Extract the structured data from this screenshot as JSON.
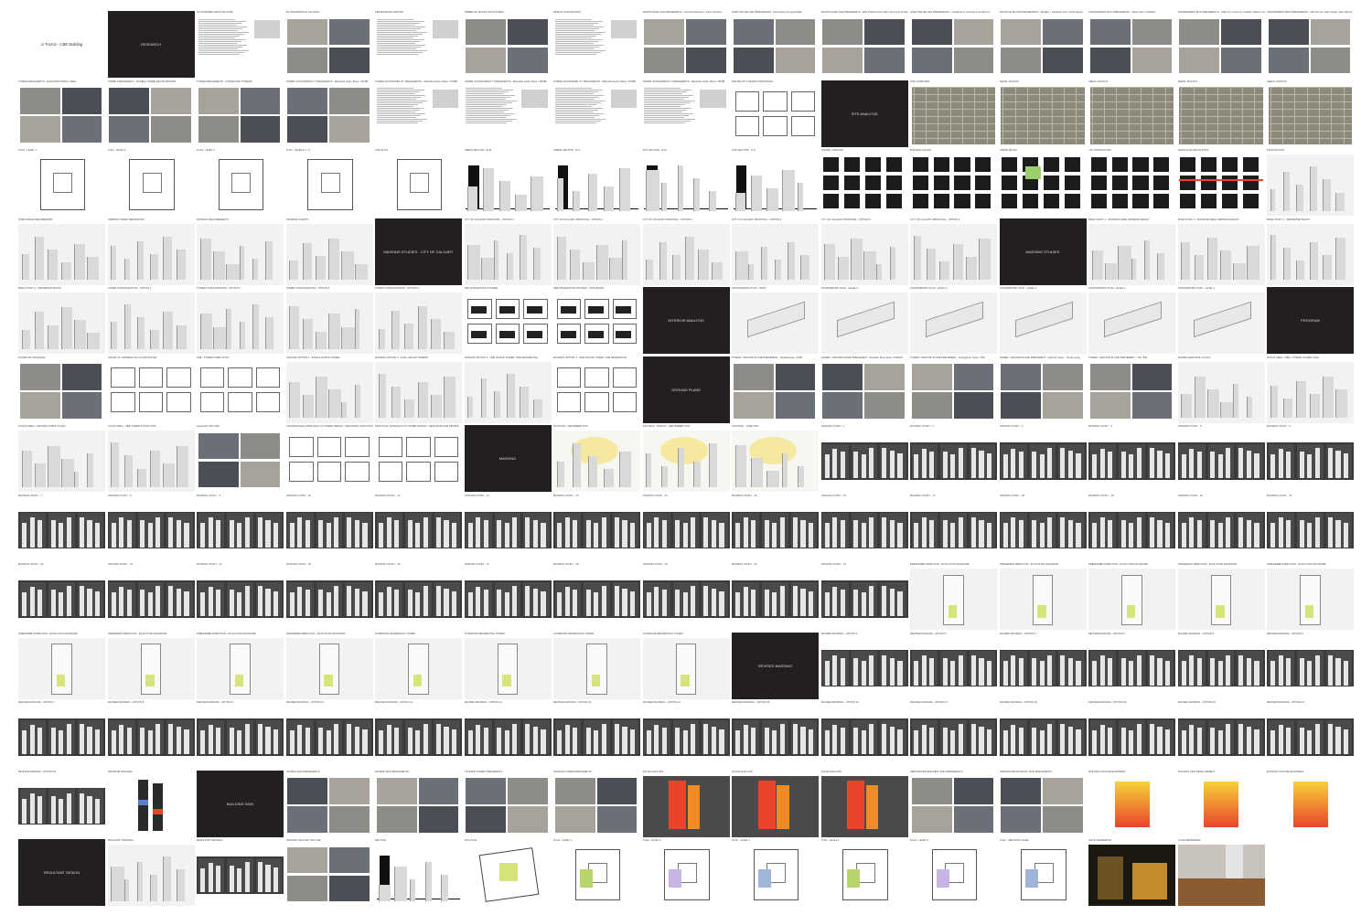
{
  "sheet": {
    "cols": 15,
    "rows": 13
  },
  "colors": {
    "dark": "#231f20",
    "strip": "#3a3a3a",
    "bldg": "#d9d9d9",
    "map": "#8d8a7c",
    "accent_yellow": "#f2de5a",
    "accent_red": "#e8452a"
  },
  "rows": [
    [
      "cover:ci TALKS - CBE Building",
      "dark:RESEARCH",
      "text:SKYSCRAPER ARCHITECTURE",
      "photo:SKYSCRAPERS IN CALGARY",
      "text:CBE BUILDING HISTORY",
      "photo:TIMBER OF MAJOR SCULPTURES",
      "text:DESIGN CONSTRAINTS",
      "photo:ADAPTIVE RE-USE PRECEDENTS - Kolumba Museum / Peter Zumthor",
      "photo:ADAPTIVE RE-USE PRECEDENTS - Nuremberg Kongresshalle",
      "photo:ADAPTIVE RE-USE PRECEDENTS - Elbe Philharmonic Hall / Herzog & de Meuron",
      "photo:ADAPTIVE RE-USE PRECEDENTS - CaixaForum / Herzog & de Meuron",
      "photo:ADAPTIVE RE-USE PRECEDENTS - Metallic + Aesthetic Fire / Adrià Hanes",
      "photo:TRANSPARENT BOX PRECEDENTS - Glass Farm / MVRDV",
      "photo:TRANSPARENT BOX PRECEDENTS - Office for Lonely by Castillo / Alberto Campo",
      "photo:TRANSPARENT BOX PRECEDENTS - 295 Concert Hall / Atelier Jean Nouvel"
    ],
    [
      "photo:TOWER PRECEDENTS - ELEVATED PUBLIC AREA",
      "photo:TOWER PRECEDENTS - DOUBLE TOWER RELATIONSHIPS",
      "photo:TOWER PRECEDENTS - CONNECTED TOWERS",
      "photo:TOWER SUSTAINABILITY PRECEDENTS - Manitoba Hydro Place / KPMB",
      "text:TOWER SUSTAINABILITY PRECEDENTS - Manitoba Hydro Place / KPMB",
      "text:TOWER SUSTAINABILITY PRECEDENTS - Manitoba Hydro Place / KPMB",
      "text:TOWER SUSTAINABILITY PRECEDENTS - Manitoba Hydro Place / KPMB",
      "text:TOWER SUSTAINABILITY PRECEDENTS - Manitoba Hydro Place / KPMB",
      "diagram:WINTER CITY DESIGN PRINCIPLES",
      "dark:SITE ANALYSIS",
      "map:SITE OVERVIEW",
      "map:AERIAL PHOTOS",
      "map:AERIAL PHOTOS",
      "map:AERIAL PHOTOS",
      "map:AERIAL PHOTOS"
    ],
    [
      "plan:PLAN - LEVEL 1",
      "plan:PLAN - LEVEL 2",
      "plan:PLAN - LEVEL 3",
      "plan:PLAN - LEVELS 4 + 5",
      "plan:SITE PLAN",
      "section:URBAN SECTION - E-W",
      "section:URBAN SECTION - N-S",
      "section:SITE SECTION - E-W",
      "section:SITE SECTION - N-S",
      "figure:FIGURE / GROUND",
      "figure:BUILDING HEIGHT",
      "figure:GREEN SPACE",
      "figure:+15 CONNECTIONS",
      "figure:VEHICULAR CIRCULATION",
      "massing:EXISTING SITE"
    ],
    [
      "massing:OPEN SPACE REQUIREMENT",
      "massing:MINIMUM TOWER SEPARATION",
      "massing:SETBACK REQUIREMENTS",
      "massing:MAXIMUM CANOPY",
      "dark:MASSING STUDIES - CITY OF CALGARY",
      "massing:CITY OF CALGARY PROPOSAL - OPTION 1",
      "massing:CITY OF CALGARY PROPOSAL - OPTION 1",
      "massing:CITY OF CALGARY PROPOSAL - OPTION 2",
      "massing:CITY OF CALGARY PROPOSAL - OPTION 2",
      "massing:CITY OF CALGARY PROPOSAL - OPTION 3",
      "massing:CITY OF CALGARY PROPOSAL - OPTION 4",
      "dark:MASSING STUDIES",
      "massing:BASE STUDY 1 - MAXIMUM AREA, MINIMUM HEIGHT",
      "massing:BASE STUDY 2 - MAXIMUM AREA, MINIMUM HEIGHT",
      "massing:BASE STUDY 3 - PERIMETER BLOCK"
    ],
    [
      "massing:BASE STUDY 4 - PERIMETER BLOCK",
      "massing:TOWER CONFIGURATION - OPTION 1",
      "massing:TOWER CONFIGURATION - OPTION 2",
      "massing:TOWER CONFIGURATION - OPTION 3",
      "massing:TOWER CONFIGURATION - OPTION 4",
      "cbe:CBE INTEGRATION STUDIES",
      "cbe:CBE INTEGRATION STUDIES - CONTINUED",
      "dark:INTERIOR ANALYSIS",
      "axo:AXONOMETRIC PLAN - ROOF",
      "axo:AXONOMETRIC PLAN - LEVEL 5",
      "axo:AXONOMETRIC PLAN - LEVEL 4",
      "axo:AXONOMETRIC PLAN - LEVEL 3",
      "axo:AXONOMETRIC PLAN - LEVEL 2",
      "axo:AXONOMETRIC PLAN - LEVEL 1",
      "dark:PROGRAM"
    ],
    [
      "photo:POTENTIAL PROGRAM",
      "diagram:OFFICE VS. RESIDENTIAL FLOOR PLATES",
      "diagram:CBE - TOWER CORE STUDY",
      "massing:MASSING OPTION 1 - SINGLE OFFICE TOWER",
      "massing:MASSING OPTION 2 - DUAL OFFICE TOWERS",
      "massing:MASSING OPTION 3 - ONE OFFICE TOWER, ONE RESIDENTIAL",
      "diagram:MASSING OPTION 4 - ONE OFFICE TOWER, ONE RESIDENTIAL",
      "dark:GROUND PLANE",
      "photo:TOWER / GROUND PLANE PRECEDENT - Mediatheque / 1998",
      "photo:TOWER / GROUND PLANE PRECEDENT - Roskilde Skyscraper / MVRDV",
      "photo:TOWER / GROUND PLANE PRECEDENT - Guangzhou Tower / BIG",
      "photo:TOWER / GROUND PLANE PRECEDENT - Highrise Tower - Studio Gang",
      "photo:TOWER / GROUND PLANE PRECEDENT - 730 / BIG",
      "massing:ESTABLISHED SITE LAYOUT",
      "massing:FOCUS AREA - CBE + TOWER CONNECTION"
    ],
    [
      "massing:FOCUS AREA - CENTRAL PUBLIC PLAZA",
      "massing:FOCUS AREA - CBE TOWER ATTRACTION",
      "photo:CALGARY SKYLINE",
      "diagram:CONVENTIONAL APPROACH TO TOWER DESIGN - DESIGNING FOR POSTCARDS",
      "diagram:PRACTICAL APPROACH TO TOWER DESIGN - DESIGNING FOR PEOPLE",
      "dark:MASSING",
      "sun:SUN PATH - DECEMBER 21ST",
      "sun:SUN PATH - MARCH + SEPTEMBER 21ST",
      "sun:SUN PATH - JUNE 21ST",
      "strip:MASSING STUDY - 1",
      "strip:MASSING STUDY - 2",
      "strip:MASSING STUDY - 3",
      "strip:MASSING STUDY - 4",
      "strip:MASSING STUDY - 5",
      "strip:MASSING STUDY - 6"
    ],
    [
      "strip:MASSING STUDY - 7",
      "strip:MASSING STUDY - 8",
      "strip:MASSING STUDY - 9",
      "strip:MASSING STUDY - 10",
      "strip:MASSING STUDY - 11",
      "strip:MASSING STUDY - 12",
      "strip:MASSING STUDY - 13",
      "strip:MASSING STUDY - 14",
      "strip:MASSING STUDY - 15",
      "strip:MASSING STUDY - 16",
      "strip:MASSING STUDY - 17",
      "strip:MASSING STUDY - 18",
      "strip:MASSING STUDY - 19",
      "strip:MASSING STUDY - 20",
      "strip:MASSING STUDY - 21"
    ],
    [
      "strip:MASSING STUDY - 22",
      "strip:MASSING STUDY - 23",
      "strip:MASSING STUDY - 24",
      "strip:MASSING STUDY - 25",
      "strip:MASSING STUDY - 26",
      "strip:MASSING STUDY - 27",
      "strip:MASSING STUDY - 28",
      "strip:MASSING STUDY - 29",
      "strip:MASSING STUDY - 30",
      "strip:MASSING STUDY - 31",
      "evo:PREFERRED DIRECTION - EVOLUTION DIAGRAMS",
      "evo:PREFERRED DIRECTION - EVOLUTION DIAGRAMS",
      "evo:PREFERRED DIRECTION - EVOLUTION DIAGRAMS",
      "evo:PREFERRED DIRECTION - EVOLUTION DIAGRAMS",
      "evo:PREFERRED DIRECTION - EVOLUTION DIAGRAMS"
    ],
    [
      "evo:PREFERRED DIRECTION - EVOLUTION DIAGRAMS",
      "evo:PREFERRED DIRECTION - EVOLUTION DIAGRAMS",
      "evo:PREFERRED DIRECTION - EVOLUTION DIAGRAMS",
      "evo:PREFERRED DIRECTION - EVOLUTION DIAGRAMS",
      "evo:ALTERNATE RESIDENTIAL TOWER",
      "evo:ALTERNATE RESIDENTIAL TOWER",
      "evo:ALTERNATE RESIDENTIAL TOWER",
      "evo:ALTERNATE RESIDENTIAL TOWER",
      "dark:REVISED MASSING",
      "strip:REVISED MASSING - OPTION 1",
      "strip:REVISED MASSING - OPTION 2",
      "strip:REVISED MASSING - OPTION 3",
      "strip:REVISED MASSING - OPTION 4",
      "strip:REVISED MASSING - OPTION 5",
      "strip:REVISED MASSING - OPTION 6"
    ],
    [
      "strip:REVISED MASSING - OPTION 7",
      "strip:REVISED MASSING - OPTION 8",
      "strip:REVISED MASSING - OPTION 9",
      "strip:REVISED MASSING - OPTION 10",
      "strip:REVISED MASSING - OPTION 11",
      "strip:REVISED MASSING - OPTION 12",
      "strip:REVISED MASSING - OPTION 13",
      "strip:REVISED MASSING - OPTION 14",
      "strip:REVISED MASSING - OPTION 15",
      "strip:REVISED MASSING - OPTION 16",
      "strip:REVISED MASSING - OPTION 17",
      "strip:REVISED MASSING - OPTION 18",
      "strip:REVISED MASSING - OPTION 19",
      "strip:REVISED MASSING - OPTION 20",
      "strip:REVISED MASSING - OPTION 21"
    ],
    [
      "strip:REVISED MASSING - OPTION 22",
      "program:PROGRAM DIAGRAM",
      "dark:BUILDING SKIN",
      "photo:DOUBLE SKIN PRECEDENTS",
      "photo:DOUBLE SKIN PRECEDENTS",
      "photo:FACETED TOWER PRECEDENTS",
      "photo:FACETED TOWER PRECEDENTS",
      "solar:SOLAR ANALYSIS",
      "solar:SOLAR ANALYSIS",
      "solar:SOLAR ANALYSIS",
      "photo:PERFORATED BUILDING SKIN PRECEDENTS",
      "photo:PERFORATED BUILDING SKIN PRECEDENTS",
      "skin:BUILDING SKIN DEVELOPMENT",
      "skin:BUILDING SKIN DEVELOPMENT",
      "skin:BUILDING SKIN DEVELOPMENT"
    ],
    [
      "dark:RESULTANT DESIGN",
      "massing:RESULTANT MASSING",
      "strip:RESULTANT MASSING",
      "photo:UPDATED CALGARY SKYLINE",
      "section:SECTION",
      "siteplan:SITE PLAN",
      "floorplan:PLAN - LEVEL 1",
      "floorplan:PLAN - LEVEL 2",
      "floorplan:PLAN - LEVEL 3",
      "floorplan:PLAN - LEVEL 4",
      "floorplan:PLAN - LEVEL 5",
      "floorplan:PLAN - CBE ROOF LEVEL",
      "night:NIGHT RENDERING",
      "plaza:PLAZA RENDERING",
      "blank:"
    ]
  ]
}
